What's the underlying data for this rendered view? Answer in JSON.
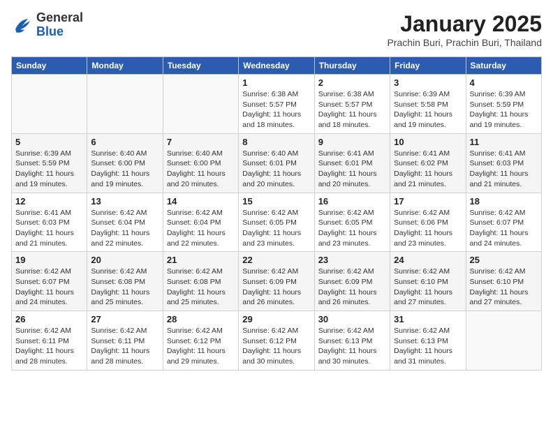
{
  "logo": {
    "general": "General",
    "blue": "Blue"
  },
  "header": {
    "title": "January 2025",
    "location": "Prachin Buri, Prachin Buri, Thailand"
  },
  "weekdays": [
    "Sunday",
    "Monday",
    "Tuesday",
    "Wednesday",
    "Thursday",
    "Friday",
    "Saturday"
  ],
  "weeks": [
    [
      {
        "day": "",
        "info": ""
      },
      {
        "day": "",
        "info": ""
      },
      {
        "day": "",
        "info": ""
      },
      {
        "day": "1",
        "info": "Sunrise: 6:38 AM\nSunset: 5:57 PM\nDaylight: 11 hours and 18 minutes."
      },
      {
        "day": "2",
        "info": "Sunrise: 6:38 AM\nSunset: 5:57 PM\nDaylight: 11 hours and 18 minutes."
      },
      {
        "day": "3",
        "info": "Sunrise: 6:39 AM\nSunset: 5:58 PM\nDaylight: 11 hours and 19 minutes."
      },
      {
        "day": "4",
        "info": "Sunrise: 6:39 AM\nSunset: 5:59 PM\nDaylight: 11 hours and 19 minutes."
      }
    ],
    [
      {
        "day": "5",
        "info": "Sunrise: 6:39 AM\nSunset: 5:59 PM\nDaylight: 11 hours and 19 minutes."
      },
      {
        "day": "6",
        "info": "Sunrise: 6:40 AM\nSunset: 6:00 PM\nDaylight: 11 hours and 19 minutes."
      },
      {
        "day": "7",
        "info": "Sunrise: 6:40 AM\nSunset: 6:00 PM\nDaylight: 11 hours and 20 minutes."
      },
      {
        "day": "8",
        "info": "Sunrise: 6:40 AM\nSunset: 6:01 PM\nDaylight: 11 hours and 20 minutes."
      },
      {
        "day": "9",
        "info": "Sunrise: 6:41 AM\nSunset: 6:01 PM\nDaylight: 11 hours and 20 minutes."
      },
      {
        "day": "10",
        "info": "Sunrise: 6:41 AM\nSunset: 6:02 PM\nDaylight: 11 hours and 21 minutes."
      },
      {
        "day": "11",
        "info": "Sunrise: 6:41 AM\nSunset: 6:03 PM\nDaylight: 11 hours and 21 minutes."
      }
    ],
    [
      {
        "day": "12",
        "info": "Sunrise: 6:41 AM\nSunset: 6:03 PM\nDaylight: 11 hours and 21 minutes."
      },
      {
        "day": "13",
        "info": "Sunrise: 6:42 AM\nSunset: 6:04 PM\nDaylight: 11 hours and 22 minutes."
      },
      {
        "day": "14",
        "info": "Sunrise: 6:42 AM\nSunset: 6:04 PM\nDaylight: 11 hours and 22 minutes."
      },
      {
        "day": "15",
        "info": "Sunrise: 6:42 AM\nSunset: 6:05 PM\nDaylight: 11 hours and 23 minutes."
      },
      {
        "day": "16",
        "info": "Sunrise: 6:42 AM\nSunset: 6:05 PM\nDaylight: 11 hours and 23 minutes."
      },
      {
        "day": "17",
        "info": "Sunrise: 6:42 AM\nSunset: 6:06 PM\nDaylight: 11 hours and 23 minutes."
      },
      {
        "day": "18",
        "info": "Sunrise: 6:42 AM\nSunset: 6:07 PM\nDaylight: 11 hours and 24 minutes."
      }
    ],
    [
      {
        "day": "19",
        "info": "Sunrise: 6:42 AM\nSunset: 6:07 PM\nDaylight: 11 hours and 24 minutes."
      },
      {
        "day": "20",
        "info": "Sunrise: 6:42 AM\nSunset: 6:08 PM\nDaylight: 11 hours and 25 minutes."
      },
      {
        "day": "21",
        "info": "Sunrise: 6:42 AM\nSunset: 6:08 PM\nDaylight: 11 hours and 25 minutes."
      },
      {
        "day": "22",
        "info": "Sunrise: 6:42 AM\nSunset: 6:09 PM\nDaylight: 11 hours and 26 minutes."
      },
      {
        "day": "23",
        "info": "Sunrise: 6:42 AM\nSunset: 6:09 PM\nDaylight: 11 hours and 26 minutes."
      },
      {
        "day": "24",
        "info": "Sunrise: 6:42 AM\nSunset: 6:10 PM\nDaylight: 11 hours and 27 minutes."
      },
      {
        "day": "25",
        "info": "Sunrise: 6:42 AM\nSunset: 6:10 PM\nDaylight: 11 hours and 27 minutes."
      }
    ],
    [
      {
        "day": "26",
        "info": "Sunrise: 6:42 AM\nSunset: 6:11 PM\nDaylight: 11 hours and 28 minutes."
      },
      {
        "day": "27",
        "info": "Sunrise: 6:42 AM\nSunset: 6:11 PM\nDaylight: 11 hours and 28 minutes."
      },
      {
        "day": "28",
        "info": "Sunrise: 6:42 AM\nSunset: 6:12 PM\nDaylight: 11 hours and 29 minutes."
      },
      {
        "day": "29",
        "info": "Sunrise: 6:42 AM\nSunset: 6:12 PM\nDaylight: 11 hours and 30 minutes."
      },
      {
        "day": "30",
        "info": "Sunrise: 6:42 AM\nSunset: 6:13 PM\nDaylight: 11 hours and 30 minutes."
      },
      {
        "day": "31",
        "info": "Sunrise: 6:42 AM\nSunset: 6:13 PM\nDaylight: 11 hours and 31 minutes."
      },
      {
        "day": "",
        "info": ""
      }
    ]
  ]
}
